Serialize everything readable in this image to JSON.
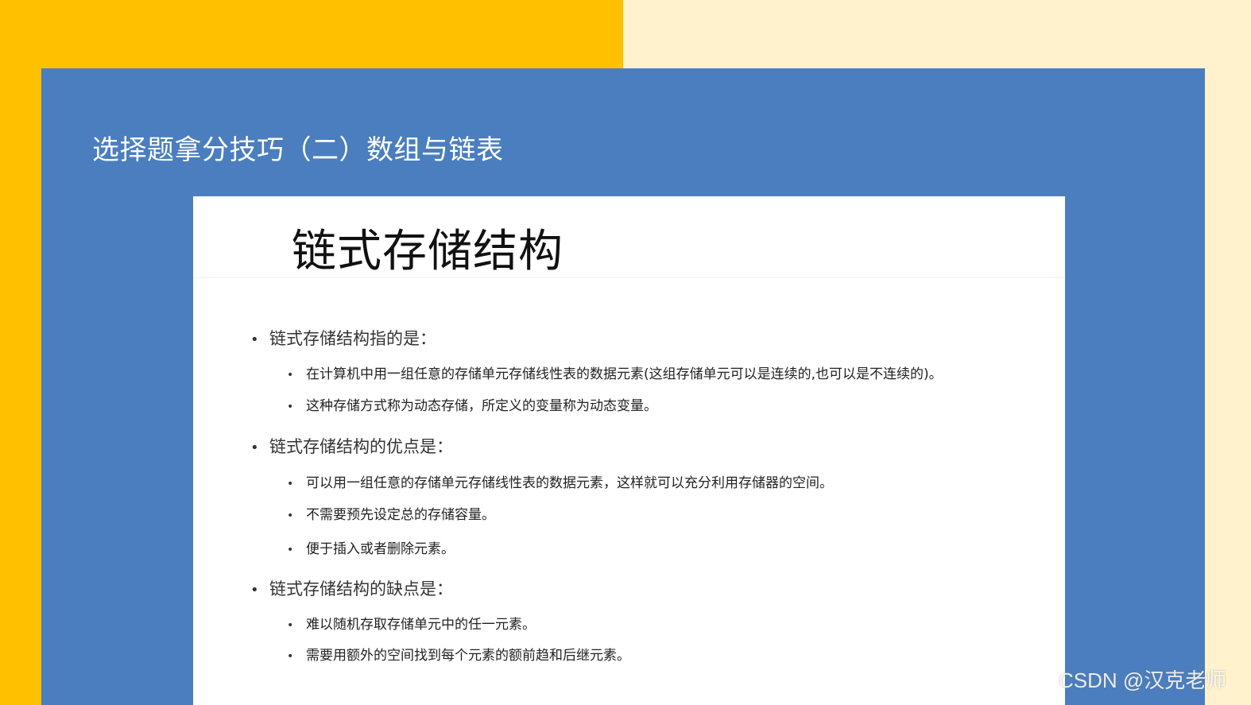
{
  "slide": {
    "title": "选择题拿分技巧（二）数组与链表"
  },
  "card": {
    "heading": "链式存储结构",
    "sections": [
      {
        "label": "链式存储结构指的是：",
        "items": [
          "在计算机中用一组任意的存储单元存储线性表的数据元素(这组存储单元可以是连续的,也可以是不连续的)。",
          "这种存储方式称为动态存储，所定义的变量称为动态变量。"
        ]
      },
      {
        "label": "链式存储结构的优点是：",
        "items": [
          "可以用一组任意的存储单元存储线性表的数据元素，这样就可以充分利用存储器的空间。",
          "不需要预先设定总的存储容量。",
          "便于插入或者删除元素。"
        ]
      },
      {
        "label": "链式存储结构的缺点是：",
        "items": [
          "难以随机存取存储单元中的任一元素。",
          "需要用额外的空间找到每个元素的额前趋和后继元素。"
        ]
      }
    ],
    "bullet_l1": "•",
    "bullet_l2": "•"
  },
  "watermark": "CSDN @汉克老师",
  "colors": {
    "yellow": "#FFC000",
    "cream": "#FFF2CC",
    "blue": "#4A7EBE",
    "card": "#FFFFFF"
  }
}
